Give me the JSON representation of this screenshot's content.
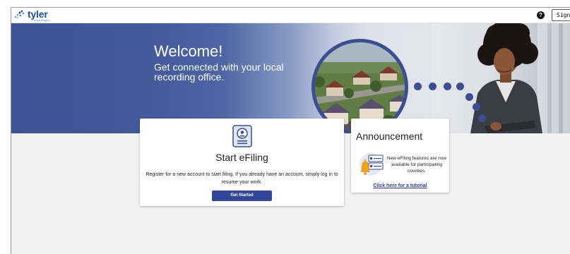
{
  "header": {
    "logo_text": "tyler",
    "logo_sub": "technologies",
    "help_glyph": "?",
    "sign_in_label": "Sign In"
  },
  "hero": {
    "welcome": "Welcome!",
    "tagline": "Get connected with your local recording office."
  },
  "start_card": {
    "title": "Start eFiling",
    "description": "Register for a new account to start filing. If you already have an account, simply log in to resume your work.",
    "button_label": "Get Started"
  },
  "announcement": {
    "title": "Announcement",
    "text": "New eFiling features are now available for participating counties.",
    "link_text": "Click here for a tutorial"
  },
  "colors": {
    "brand_blue": "#34469a",
    "link_blue": "#2b3f99",
    "logo_blue": "#1c4fa1",
    "bell_orange": "#f0a020"
  }
}
